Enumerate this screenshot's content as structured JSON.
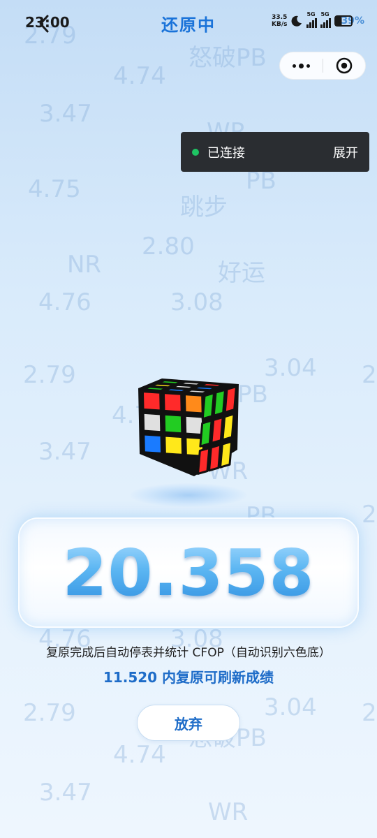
{
  "status_bar": {
    "time": "23:00",
    "net_speed_value": "33.5",
    "net_speed_unit": "KB/s",
    "sim1_label": "5G",
    "sim2_label": "5G",
    "battery_percent": "39%"
  },
  "header": {
    "title": "还原中"
  },
  "capsule_menu": {
    "more_icon": "more-dots-icon",
    "close_icon": "target-close-icon"
  },
  "connection": {
    "status_text": "已连接",
    "expand_label": "展开",
    "status_color": "#1ec463"
  },
  "background_watermarks": [
    "2.79",
    "怒破PB",
    "4.74",
    "3.47",
    "WR",
    "PB",
    "4.75",
    "跳步",
    "2.80",
    "NR",
    "好运",
    "4.76",
    "3.08",
    "3.04",
    "2.79",
    "PB",
    "4.7",
    "3.47",
    "WR",
    "PB",
    "4.76",
    "3.08",
    "2.79",
    "3.04",
    "怒破PB",
    "4.74",
    "3.47",
    "WR",
    "2",
    "2",
    "2"
  ],
  "cube": {
    "icon": "rubiks-cube-icon",
    "front_face": [
      "#ff2a2a",
      "#ff2a2a",
      "#ff8a1a",
      "#e0e0e0",
      "#22cc22",
      "#e0e0e0",
      "#1a7bff",
      "#ffe81a",
      "#ffe81a"
    ],
    "top_face": [
      "#22cc22",
      "#1a7bff",
      "#e0e0e0",
      "#ffe81a",
      "#e0e0e0",
      "#1a7bff",
      "#22cc22",
      "#e0e0e0",
      "#ff2a2a"
    ],
    "right_face": [
      "#22cc22",
      "#22cc22",
      "#ff2a2a",
      "#22cc22",
      "#ff2a2a",
      "#ffe81a",
      "#ff2a2a",
      "#ff2a2a",
      "#ffe81a"
    ]
  },
  "timer": {
    "value": "20.358"
  },
  "hint": {
    "text": "复原完成后自动停表并统计 CFOP（自动识别六色底）"
  },
  "refresh": {
    "text": "11.520 内复原可刷新成绩"
  },
  "actions": {
    "give_up_label": "放弃"
  },
  "colors": {
    "title_blue": "#1a73d9",
    "accent_blue": "#1e6cc8",
    "timer_blue": "#56b2f2"
  }
}
